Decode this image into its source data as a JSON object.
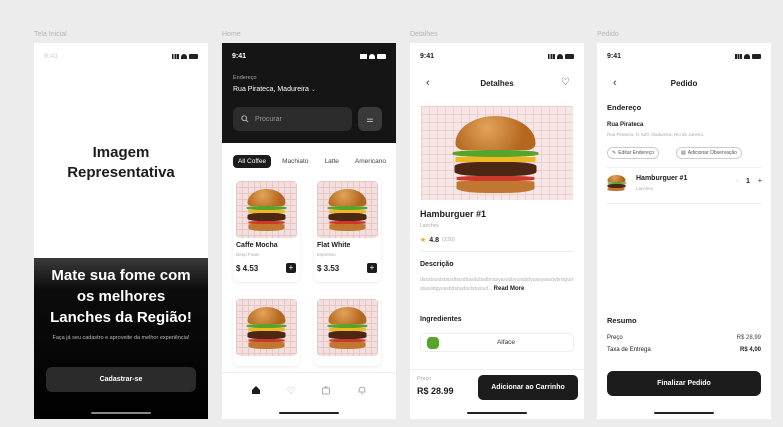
{
  "frames": {
    "frame1_label": "Tela Inicial",
    "frame2_label": "Home",
    "frame3_label": "Detalhes",
    "frame4_label": "Pedido"
  },
  "status": {
    "time": "9:41"
  },
  "splash": {
    "image_placeholder_line1": "Imagem",
    "image_placeholder_line2": "Representativa",
    "headline_line1": "Mate sua fome com",
    "headline_line2": "os melhores",
    "headline_line3": "Lanches da Região!",
    "subtitle": "Faça já seu cadastro e aproveite da melhor experiência!",
    "cta_label": "Cadastrar-se"
  },
  "home": {
    "address_label": "Endereço",
    "address_value": "Rua Pirateca, Madureira",
    "search_placeholder": "Procurar",
    "categories": [
      "All Coffee",
      "Machiato",
      "Latte",
      "Americano"
    ],
    "products": [
      {
        "name": "Caffe Mocha",
        "desc": "Deep Foam",
        "price": "$ 4.53"
      },
      {
        "name": "Flat White",
        "desc": "Espresso",
        "price": "$ 3.53"
      }
    ],
    "add_symbol": "+",
    "tabs": [
      "home-icon",
      "heart-icon",
      "bag-icon",
      "bell-icon"
    ]
  },
  "details": {
    "header_title": "Detalhes",
    "product_title": "Hamburguer #1",
    "product_subtitle": "Lanches",
    "rating": "4.8",
    "rating_count": "(230)",
    "description_heading": "Descrição",
    "description_text": "dassbasdsdasdhasdhasdubsdbnasyasdsbyuasbdyuasyaasdybnsgudsbaslidgyuasbdsbudasbdasiud...",
    "read_more": "Read More",
    "ingredients_heading": "Ingredientes",
    "ingredient_1": "Alface",
    "price_label": "Preço",
    "price_value": "R$ 28.99",
    "add_to_cart": "Adicionar ao Carrinho"
  },
  "order": {
    "header_title": "Pedido",
    "address_heading": "Endereço",
    "street": "Rua Pirateca",
    "street_detail": "Rua Pirateca, N. 620, Madureira, Rio de Janeiro.",
    "edit_address": "Editar Endereço",
    "add_note": "Adicionar Observação",
    "item_name": "Hamburguer #1",
    "item_sub": "Lanches",
    "qty_minus": "-",
    "qty_value": "1",
    "qty_plus": "+",
    "summary_heading": "Resumo",
    "price_label": "Preço",
    "price_value": "R$ 28,99",
    "delivery_label": "Taxa de Entrega",
    "delivery_value": "R$ 4,00",
    "finish_label": "Finalizar Pedido"
  }
}
